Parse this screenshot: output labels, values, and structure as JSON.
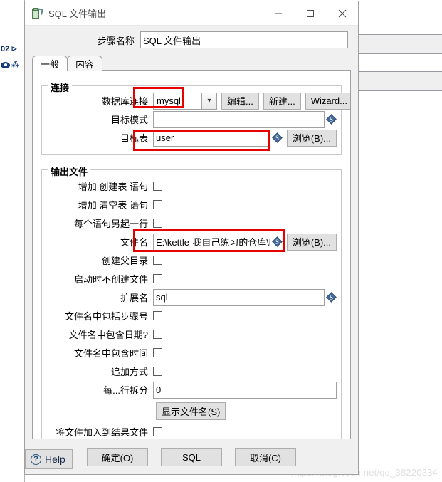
{
  "background": {
    "left_panel": {
      "row1_text": "02",
      "row1_glyph": "branch-icon",
      "row2_glyph": "eye-icon",
      "row2_glyph2": "connector-icon"
    },
    "watermark": "https://blog.csdn.net/qq_38220334"
  },
  "window": {
    "title": "SQL 文件输出",
    "icon": "sql-file-output-icon",
    "minimize_label": "—",
    "maximize_label": "☐",
    "close_label": "✕"
  },
  "step": {
    "label": "步骤名称",
    "value": "SQL 文件输出"
  },
  "tabs": [
    {
      "label": "一般",
      "active": true
    },
    {
      "label": "内容",
      "active": false
    }
  ],
  "connection_group": {
    "title": "连接",
    "db_connection": {
      "label": "数据库连接",
      "value": "mysql",
      "edit_button": "编辑...",
      "new_button": "新建...",
      "wizard_button": "Wizard..."
    },
    "target_schema": {
      "label": "目标模式",
      "value": ""
    },
    "target_table": {
      "label": "目标表",
      "value": "user",
      "browse_button": "浏览(B)..."
    }
  },
  "output_group": {
    "title": "输出文件",
    "add_create_table": {
      "label": "增加 创建表 语句",
      "checked": false
    },
    "add_truncate_table": {
      "label": "增加 清空表 语句",
      "checked": false
    },
    "statement_new_line": {
      "label": "每个语句另起一行",
      "checked": false
    },
    "filename": {
      "label": "文件名",
      "value": "E:\\kettle-我自己练习的仓库\\ke",
      "browse_button": "浏览(B)..."
    },
    "create_parent_folder": {
      "label": "创建父目录",
      "checked": false
    },
    "no_file_at_start": {
      "label": "启动时不创建文件",
      "checked": false
    },
    "extension": {
      "label": "扩展名",
      "value": "sql"
    },
    "include_step_nr": {
      "label": "文件名中包括步骤号",
      "checked": false
    },
    "include_date": {
      "label": "文件名中包含日期?",
      "checked": false
    },
    "include_time": {
      "label": "文件名中包含时间",
      "checked": false
    },
    "append_mode": {
      "label": "追加方式",
      "checked": false
    },
    "split_every": {
      "label": "每...行拆分",
      "value": "0"
    },
    "show_filenames_button": "显示文件名(S)",
    "add_file_to_result": {
      "label": "将文件加入到结果文件",
      "checked": false
    }
  },
  "footer": {
    "help_button": "Help",
    "ok_button": "确定(O)",
    "sql_button": "SQL",
    "cancel_button": "取消(C)"
  },
  "annotations": {
    "color": "#e60000",
    "highlights": [
      "db-connection-value",
      "target-table-value",
      "filename-value"
    ]
  }
}
